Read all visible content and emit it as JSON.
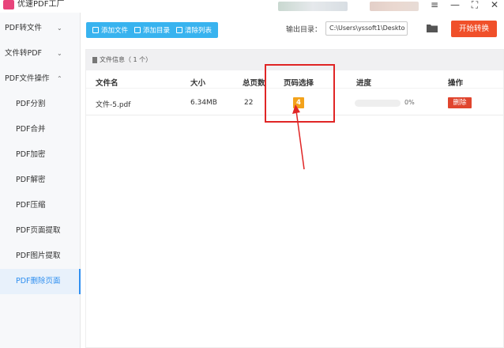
{
  "app": {
    "title": "优速PDF工厂"
  },
  "window_controls": {
    "menu": "≡",
    "minimize": "—",
    "maximize": "⛶",
    "close": "✕"
  },
  "sidebar": {
    "items": [
      {
        "label": "PDF转文件",
        "chevron": "⌄"
      },
      {
        "label": "文件转PDF",
        "chevron": "⌄"
      },
      {
        "label": "PDF文件操作",
        "chevron": "⌃"
      },
      {
        "label": "PDF分割"
      },
      {
        "label": "PDF合并"
      },
      {
        "label": "PDF加密"
      },
      {
        "label": "PDF解密"
      },
      {
        "label": "PDF压缩"
      },
      {
        "label": "PDF页面提取"
      },
      {
        "label": "PDF图片提取"
      },
      {
        "label": "PDF删除页面"
      }
    ],
    "active_index": 10
  },
  "toolbar": {
    "add_file": "添加文件",
    "add_dir": "添加目录",
    "clear_list": "清除列表",
    "output_label": "输出目录：",
    "output_path": "C:\\Users\\yssoft1\\Deskto",
    "start_button": "开始转换"
  },
  "panel": {
    "file_info": "文件信息（ 1 个）",
    "columns": [
      "文件名",
      "大小",
      "总页数",
      "页码选择",
      "进度",
      "操作"
    ],
    "rows": [
      {
        "name": "文件-5.pdf",
        "size": "6.34MB",
        "pages": "22",
        "page_select": "4",
        "progress_pct": "0%",
        "progress_value": 0,
        "action": "删除"
      }
    ]
  },
  "colors": {
    "accent_blue": "#38b3ef",
    "start_orange": "#f0502a",
    "badge_orange": "#f3a21b",
    "delete_red": "#e0452e",
    "annotation_red": "#e02525"
  }
}
